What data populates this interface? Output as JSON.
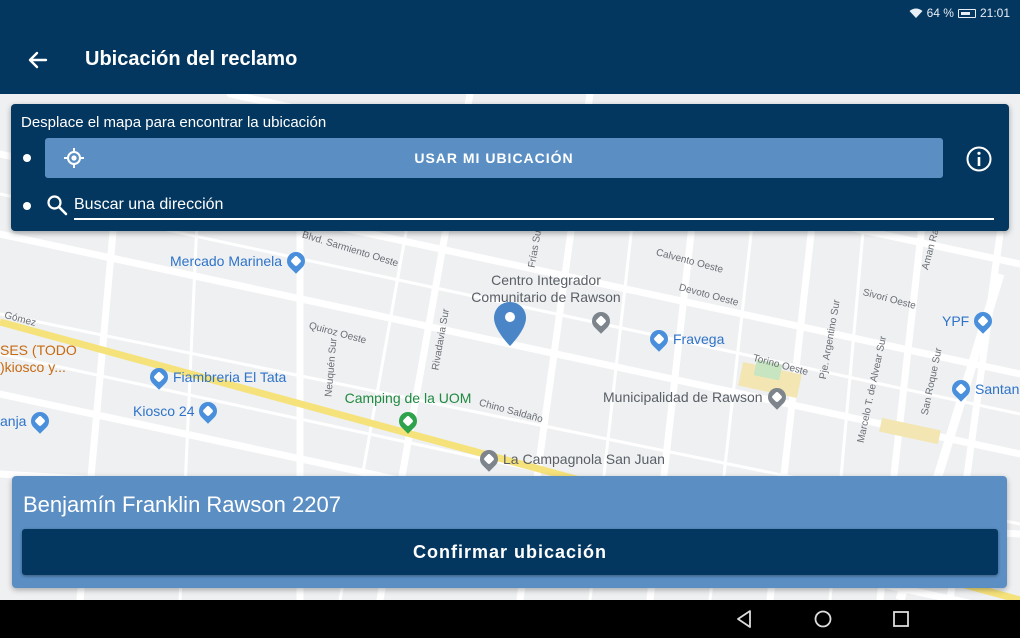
{
  "status_bar": {
    "battery": "64 %",
    "time": "21:01"
  },
  "app_bar": {
    "title": "Ubicación del reclamo"
  },
  "search_panel": {
    "hint": "Desplace el mapa para encontrar la ubicación",
    "use_location_label": "USAR MI UBICACIÓN",
    "search_placeholder": "Buscar una dirección"
  },
  "map": {
    "pois": [
      {
        "name": "Mercado Marinela",
        "kind": "blue"
      },
      {
        "name": "Fiambreria El Tata",
        "kind": "blue"
      },
      {
        "name": "Kiosco 24",
        "kind": "blue"
      },
      {
        "name": "anja",
        "kind": "blue"
      },
      {
        "name": "Fravega",
        "kind": "blue"
      },
      {
        "name": "YPF",
        "kind": "blue"
      },
      {
        "name": "Santan",
        "kind": "blue"
      },
      {
        "name": "Centro Integrador Comunitario de Rawson",
        "kind": "gray"
      },
      {
        "name": "Municipalidad de Rawson",
        "kind": "gray"
      },
      {
        "name": "La Campagnola San Juan",
        "kind": "gray"
      },
      {
        "name": "Camping de la UOM",
        "kind": "green"
      },
      {
        "name": "SES (TODO )kiosco y...",
        "kind": "orange"
      }
    ],
    "streets": [
      "Blvd. Sarmiento Oeste",
      "Quiroz Oeste",
      "Chino Saldaño",
      "Calvento Oeste",
      "Devoto Oeste",
      "Sivori Oeste",
      "Torino Oeste",
      "Rivadavia Sur",
      "Neuquén Sur",
      "Frías Sur",
      "Pje. Argentino Sur",
      "Marcelo T. de Alvear Sur",
      "San Roque Sur",
      "Gómez",
      "Aman Ra"
    ]
  },
  "bottom_card": {
    "address": "Benjamín Franklin Rawson 2207",
    "confirm_label": "Confirmar ubicación"
  },
  "colors": {
    "primary": "#04375f",
    "accent": "#5b8fc4"
  },
  "icons": [
    "back-arrow-icon",
    "wifi-icon",
    "battery-icon",
    "my-location-icon",
    "info-icon",
    "search-icon",
    "location-marker-icon",
    "nav-back-icon",
    "nav-home-icon",
    "nav-recents-icon"
  ]
}
